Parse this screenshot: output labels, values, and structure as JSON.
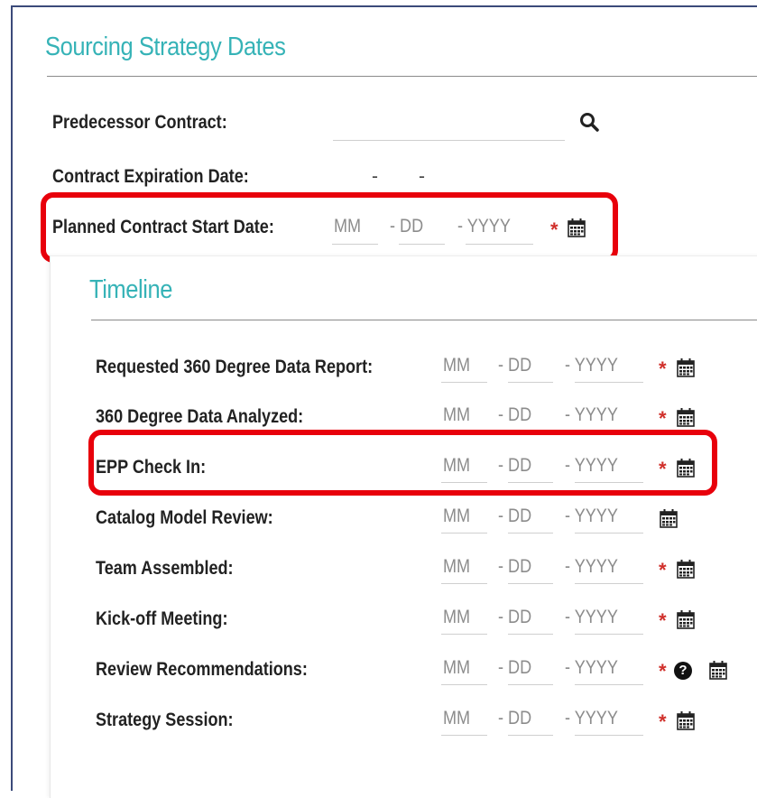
{
  "sourcing": {
    "title": "Sourcing Strategy Dates",
    "predecessor_label": "Predecessor Contract:",
    "predecessor_value": "",
    "expiration_label": "Contract Expiration Date:",
    "expiration_dash1": "-",
    "expiration_dash2": "-",
    "planned_label": "Planned Contract Start Date:",
    "mm": "MM",
    "dd": "- DD",
    "yyyy": "- YYYY",
    "required_mark": "*"
  },
  "timeline": {
    "title": "Timeline",
    "mm": "MM",
    "dd": "- DD",
    "yyyy": "- YYYY",
    "required_mark": "*",
    "help_mark": "?",
    "rows": [
      {
        "label": "Requested 360 Degree Data Report:",
        "required": true
      },
      {
        "label": "360 Degree Data Analyzed:",
        "required": true
      },
      {
        "label": "EPP Check In:",
        "required": true
      },
      {
        "label": "Catalog Model Review:",
        "required": false
      },
      {
        "label": "Team Assembled:",
        "required": true
      },
      {
        "label": "Kick-off Meeting:",
        "required": true
      },
      {
        "label": "Review Recommendations:",
        "required": true,
        "help": true
      },
      {
        "label": "Strategy Session:",
        "required": true
      }
    ]
  },
  "colors": {
    "heading": "#36b3b7",
    "required": "#d0302b",
    "highlight": "#e8000b"
  },
  "icons": {
    "calendar": "calendar-icon",
    "search": "search-icon",
    "help": "help-icon"
  }
}
